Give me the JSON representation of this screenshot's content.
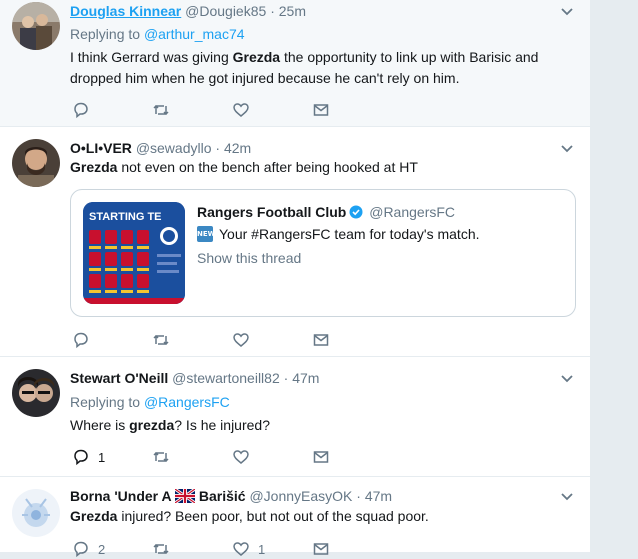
{
  "tweets": [
    {
      "name": "Douglas Kinnear",
      "handle": "@Dougiek85",
      "dot": "·",
      "time": "25m",
      "reply_prefix": "Replying to ",
      "reply_handle": "@arthur_mac74",
      "text_a": "I think Gerrard was giving ",
      "text_bold": "Grezda",
      "text_b": " the opportunity to link up with Barisic and dropped him when he got injured because he can't rely on him."
    },
    {
      "name": "O•LI•VER",
      "handle": "@sewadyllo",
      "dot": "·",
      "time": "42m",
      "text_bold": "Grezda",
      "text_b": " not even on the bench after being hooked at HT",
      "card": {
        "image_title": "STARTING TE",
        "name": "Rangers Football Club",
        "handle": "@RangersFC",
        "badge": "NEW",
        "text": "Your #RangersFC team for today's match.",
        "link": "Show this thread"
      }
    },
    {
      "name": "Stewart O'Neill",
      "handle": "@stewartoneill82",
      "dot": "·",
      "time": "47m",
      "reply_prefix": "Replying to ",
      "reply_handle": "@RangersFC",
      "text_a": "Where is ",
      "text_bold": "grezda",
      "text_b": "? Is he injured?",
      "reply_count": "1"
    },
    {
      "name_a": "Borna 'Under A ",
      "name_b": " Barišić",
      "handle": "@JonnyEasyOK",
      "dot": "·",
      "time": "47m",
      "text_bold": "Grezda",
      "text_b": " injured? Been poor, but not out of the squad poor.",
      "reply_count": "2",
      "like_count": "1"
    }
  ],
  "colors": {
    "accent": "#1da1f2",
    "muted": "#657786",
    "border": "#e6ecf0",
    "highlight": "#f5f8fa"
  },
  "icons": [
    "reply-icon",
    "retweet-icon",
    "like-icon",
    "dm-icon",
    "chevron-down-icon",
    "verified-icon",
    "uk-flag-icon"
  ]
}
